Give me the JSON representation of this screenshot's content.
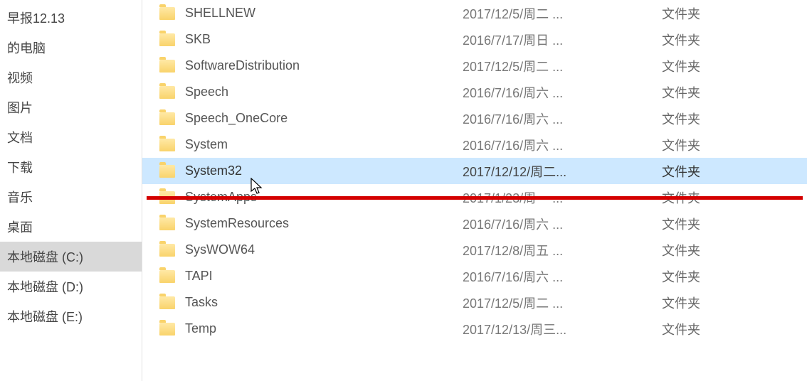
{
  "sidebar": {
    "items": [
      {
        "label": "早报12.13",
        "selected": false
      },
      {
        "label": "的电脑",
        "selected": false
      },
      {
        "label": "视频",
        "selected": false
      },
      {
        "label": "图片",
        "selected": false
      },
      {
        "label": "文档",
        "selected": false
      },
      {
        "label": "下载",
        "selected": false
      },
      {
        "label": "音乐",
        "selected": false
      },
      {
        "label": "桌面",
        "selected": false
      },
      {
        "label": "本地磁盘 (C:)",
        "selected": true
      },
      {
        "label": "本地磁盘 (D:)",
        "selected": false
      },
      {
        "label": "本地磁盘 (E:)",
        "selected": false
      }
    ]
  },
  "files": [
    {
      "name": "SHELLNEW",
      "date": "2017/12/5/周二 ...",
      "type": "文件夹",
      "selected": false
    },
    {
      "name": "SKB",
      "date": "2016/7/17/周日 ...",
      "type": "文件夹",
      "selected": false
    },
    {
      "name": "SoftwareDistribution",
      "date": "2017/12/5/周二 ...",
      "type": "文件夹",
      "selected": false
    },
    {
      "name": "Speech",
      "date": "2016/7/16/周六 ...",
      "type": "文件夹",
      "selected": false
    },
    {
      "name": "Speech_OneCore",
      "date": "2016/7/16/周六 ...",
      "type": "文件夹",
      "selected": false
    },
    {
      "name": "System",
      "date": "2016/7/16/周六 ...",
      "type": "文件夹",
      "selected": false
    },
    {
      "name": "System32",
      "date": "2017/12/12/周二...",
      "type": "文件夹",
      "selected": true
    },
    {
      "name": "SystemApps",
      "date": "2017/1/23/周一 ...",
      "type": "文件夹",
      "selected": false
    },
    {
      "name": "SystemResources",
      "date": "2016/7/16/周六 ...",
      "type": "文件夹",
      "selected": false
    },
    {
      "name": "SysWOW64",
      "date": "2017/12/8/周五 ...",
      "type": "文件夹",
      "selected": false
    },
    {
      "name": "TAPI",
      "date": "2016/7/16/周六 ...",
      "type": "文件夹",
      "selected": false
    },
    {
      "name": "Tasks",
      "date": "2017/12/5/周二 ...",
      "type": "文件夹",
      "selected": false
    },
    {
      "name": "Temp",
      "date": "2017/12/13/周三...",
      "type": "文件夹",
      "selected": false
    }
  ]
}
